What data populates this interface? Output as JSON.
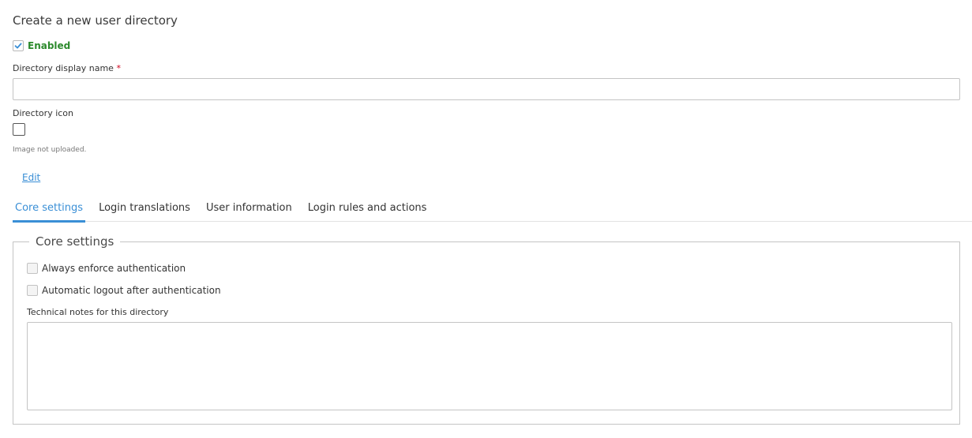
{
  "page": {
    "title": "Create a new user directory"
  },
  "enabled": {
    "label": "Enabled",
    "checked": true
  },
  "display_name": {
    "label": "Directory display name",
    "required_mark": "*",
    "value": "",
    "placeholder": ""
  },
  "directory_icon": {
    "label": "Directory icon",
    "status": "Image not uploaded.",
    "edit_label": "Edit"
  },
  "tabs": [
    {
      "label": "Core settings",
      "active": true
    },
    {
      "label": "Login translations",
      "active": false
    },
    {
      "label": "User information",
      "active": false
    },
    {
      "label": "Login rules and actions",
      "active": false
    }
  ],
  "core_settings": {
    "legend": "Core settings",
    "always_enforce_label": "Always enforce authentication",
    "always_enforce_checked": false,
    "auto_logout_label": "Automatic logout after authentication",
    "auto_logout_checked": false,
    "notes_label": "Technical notes for this directory",
    "notes_value": ""
  },
  "colors": {
    "accent": "#3a8fd6",
    "enabled_green": "#2c8a2c",
    "required_red": "#d0021b"
  }
}
